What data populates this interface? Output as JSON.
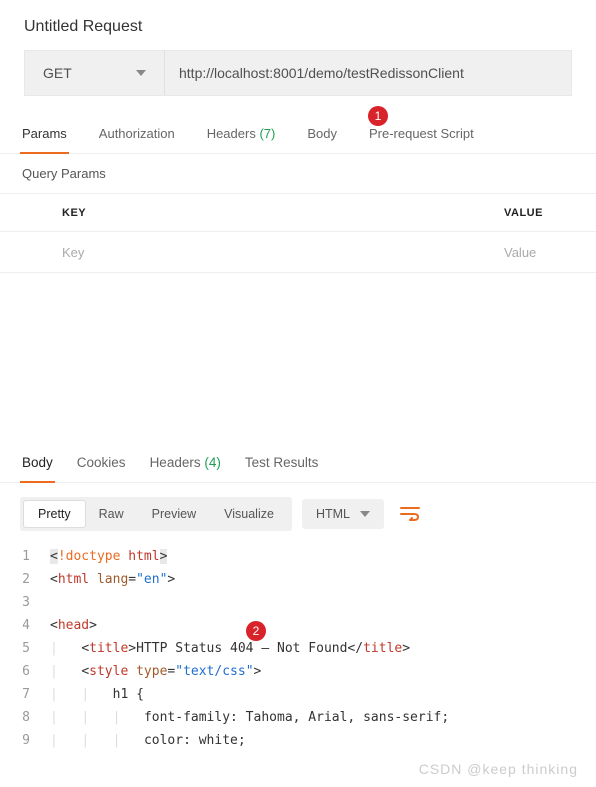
{
  "request": {
    "title": "Untitled Request",
    "method": "GET",
    "url": "http://localhost:8001/demo/testRedissonClient",
    "tabs": [
      {
        "label": "Params",
        "active": true
      },
      {
        "label": "Authorization"
      },
      {
        "label": "Headers",
        "count": "(7)"
      },
      {
        "label": "Body"
      },
      {
        "label": "Pre-request Script"
      }
    ],
    "queryParams": {
      "title": "Query Params",
      "cols": {
        "key": "KEY",
        "value": "VALUE"
      },
      "placeholder": {
        "key": "Key",
        "value": "Value"
      }
    }
  },
  "response": {
    "tabs": [
      {
        "label": "Body",
        "active": true
      },
      {
        "label": "Cookies"
      },
      {
        "label": "Headers",
        "count": "(4)"
      },
      {
        "label": "Test Results"
      }
    ],
    "view": {
      "pretty": "Pretty",
      "raw": "Raw",
      "preview": "Preview",
      "visualize": "Visualize"
    },
    "lang": "HTML",
    "code": [
      {
        "n": "1",
        "parts": [
          {
            "t": "<",
            "c": "t-cur"
          },
          {
            "t": "!doctype ",
            "c": "t-special"
          },
          {
            "t": "html",
            "c": "t-tag"
          },
          {
            "t": ">",
            "c": "t-cur"
          }
        ]
      },
      {
        "n": "2",
        "parts": [
          {
            "t": "<"
          },
          {
            "t": "html ",
            "c": "t-tag"
          },
          {
            "t": "lang",
            "c": "t-attr"
          },
          {
            "t": "="
          },
          {
            "t": "\"en\"",
            "c": "t-str"
          },
          {
            "t": ">"
          }
        ]
      },
      {
        "n": "3",
        "parts": []
      },
      {
        "n": "4",
        "parts": [
          {
            "t": "<"
          },
          {
            "t": "head",
            "c": "t-tag"
          },
          {
            "t": ">"
          }
        ]
      },
      {
        "n": "5",
        "indent": 1,
        "parts": [
          {
            "t": "<"
          },
          {
            "t": "title",
            "c": "t-tag"
          },
          {
            "t": ">HTTP Status 404 – Not Found</"
          },
          {
            "t": "title",
            "c": "t-tag"
          },
          {
            "t": ">"
          }
        ]
      },
      {
        "n": "6",
        "indent": 1,
        "parts": [
          {
            "t": "<"
          },
          {
            "t": "style ",
            "c": "t-tag"
          },
          {
            "t": "type",
            "c": "t-attr"
          },
          {
            "t": "="
          },
          {
            "t": "\"text/css\"",
            "c": "t-str"
          },
          {
            "t": ">"
          }
        ]
      },
      {
        "n": "7",
        "indent": 2,
        "parts": [
          {
            "t": "h1 {"
          }
        ]
      },
      {
        "n": "8",
        "indent": 3,
        "parts": [
          {
            "t": "font-family: Tahoma, Arial, sans-serif;"
          }
        ]
      },
      {
        "n": "9",
        "indent": 3,
        "parts": [
          {
            "t": "color: white;"
          }
        ]
      }
    ]
  },
  "badges": {
    "b1": "1",
    "b2": "2"
  },
  "watermark": "CSDN @keep   thinking"
}
